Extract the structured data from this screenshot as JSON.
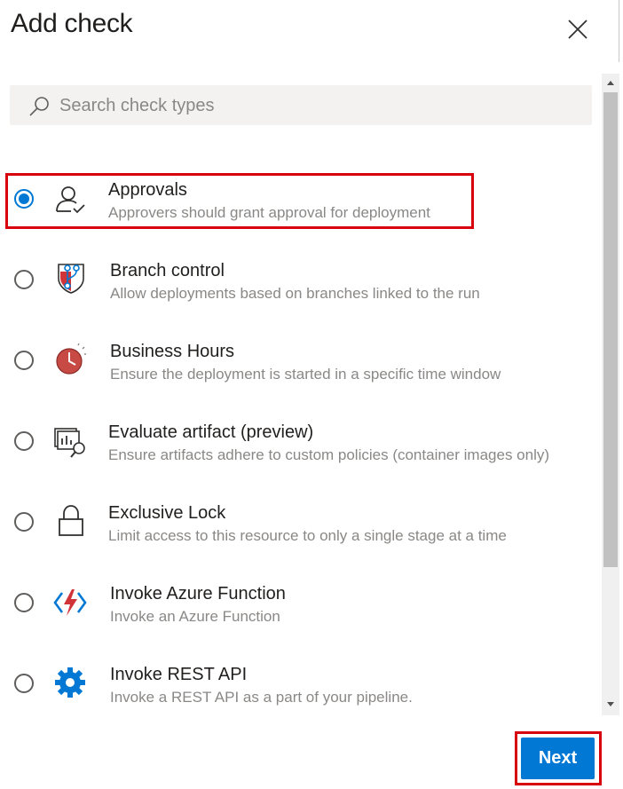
{
  "dialog": {
    "title": "Add check",
    "close_icon": "close-icon"
  },
  "search": {
    "placeholder": "Search check types",
    "value": "",
    "icon": "search-icon"
  },
  "checks": [
    {
      "title": "Approvals",
      "description": "Approvers should grant approval for deployment",
      "icon": "approvals-icon",
      "selected": true
    },
    {
      "title": "Branch control",
      "description": "Allow deployments based on branches linked to the run",
      "icon": "branch-control-icon",
      "selected": false
    },
    {
      "title": "Business Hours",
      "description": "Ensure the deployment is started in a specific time window",
      "icon": "business-hours-icon",
      "selected": false
    },
    {
      "title": "Evaluate artifact (preview)",
      "description": "Ensure artifacts adhere to custom policies (container images only)",
      "icon": "evaluate-artifact-icon",
      "selected": false
    },
    {
      "title": "Exclusive Lock",
      "description": "Limit access to this resource to only a single stage at a time",
      "icon": "lock-icon",
      "selected": false
    },
    {
      "title": "Invoke Azure Function",
      "description": "Invoke an Azure Function",
      "icon": "azure-function-icon",
      "selected": false
    },
    {
      "title": "Invoke REST API",
      "description": "Invoke a REST API as a part of your pipeline.",
      "icon": "gear-icon",
      "selected": false
    }
  ],
  "footer": {
    "next_label": "Next"
  },
  "colors": {
    "accent": "#0078d4",
    "highlight": "#d9000d"
  }
}
